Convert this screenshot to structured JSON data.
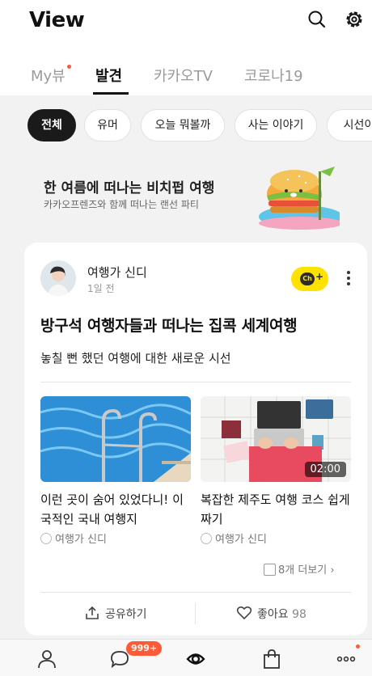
{
  "header": {
    "title": "View",
    "icons": [
      "search-icon",
      "settings-icon"
    ]
  },
  "tabs": [
    {
      "label": "My뷰",
      "active": false,
      "has_dot": true
    },
    {
      "label": "발견",
      "active": true
    },
    {
      "label": "카카오TV",
      "active": false
    },
    {
      "label": "코로나19",
      "active": false
    }
  ],
  "categories": [
    {
      "label": "전체",
      "active": true
    },
    {
      "label": "유머"
    },
    {
      "label": "오늘 뭐볼까"
    },
    {
      "label": "사는 이야기"
    },
    {
      "label": "시선이"
    }
  ],
  "banner": {
    "title": "한 여름에 떠나는 비치펍 여행",
    "subtitle": "카카오프렌즈와 함께 떠나는 랜선 파티"
  },
  "post": {
    "author": "여행가 신디",
    "time": "1일 전",
    "channel_button": "Ch+",
    "headline": "방구석 여행자들과 떠나는 집콕 세계여행",
    "subline": "놓칠 뻔 했던 여행에 대한 새로운 시선",
    "items": [
      {
        "title": "이런 곳이 숨어 있었다니! 이국적인 국내 여행지",
        "source": "여행가 신디"
      },
      {
        "title": "복잡한 제주도 여행 코스 쉽게 짜기",
        "source": "여행가 신디",
        "duration": "02:00"
      }
    ],
    "more_label": "8개 더보기",
    "share_label": "공유하기",
    "like_label": "좋아요",
    "like_count": "98"
  },
  "bottom_nav": {
    "items": [
      "friends-icon",
      "chat-icon",
      "view-icon",
      "shopping-icon",
      "more-icon"
    ],
    "chat_badge": "999+",
    "colors": {
      "accent": "#ff5a36",
      "channel": "#ffe200"
    }
  }
}
